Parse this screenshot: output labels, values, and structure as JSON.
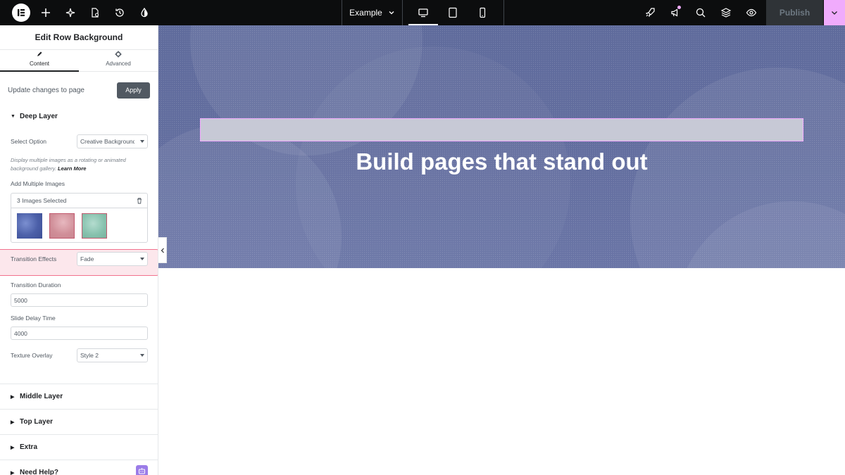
{
  "topbar": {
    "page_name": "Example",
    "publish_label": "Publish"
  },
  "panel": {
    "title": "Edit Row Background",
    "tabs": [
      {
        "label": "Content",
        "active": true
      },
      {
        "label": "Advanced",
        "active": false
      }
    ],
    "apply_label": "Update changes to page",
    "apply_button": "Apply",
    "deep_layer": {
      "title": "Deep Layer",
      "select_option_label": "Select Option",
      "select_option_value": "Creative Background",
      "help_text": "Display multiple images as a rotating or animated background gallery.",
      "help_link": "Learn More",
      "add_images_label": "Add Multiple Images",
      "images_selected": "3 Images Selected",
      "thumbnails": [
        "blue",
        "pink",
        "teal"
      ],
      "transition_effects_label": "Transition Effects",
      "transition_effects_value": "Fade",
      "transition_duration_label": "Transition Duration",
      "transition_duration_value": "5000",
      "slide_delay_label": "Slide Delay Time",
      "slide_delay_value": "4000",
      "texture_overlay_label": "Texture Overlay",
      "texture_overlay_value": "Style 2"
    },
    "sections": [
      {
        "title": "Middle Layer"
      },
      {
        "title": "Top Layer"
      },
      {
        "title": "Extra"
      },
      {
        "title": "Need Help?"
      }
    ]
  },
  "canvas": {
    "heading": "Build pages that stand out"
  },
  "colors": {
    "topbar_bg": "#0c0d0e",
    "accent_pink": "#f0abfc",
    "hero_bg": "#636e9f",
    "highlight_border": "#f2728e",
    "apply_bg": "#515962"
  }
}
